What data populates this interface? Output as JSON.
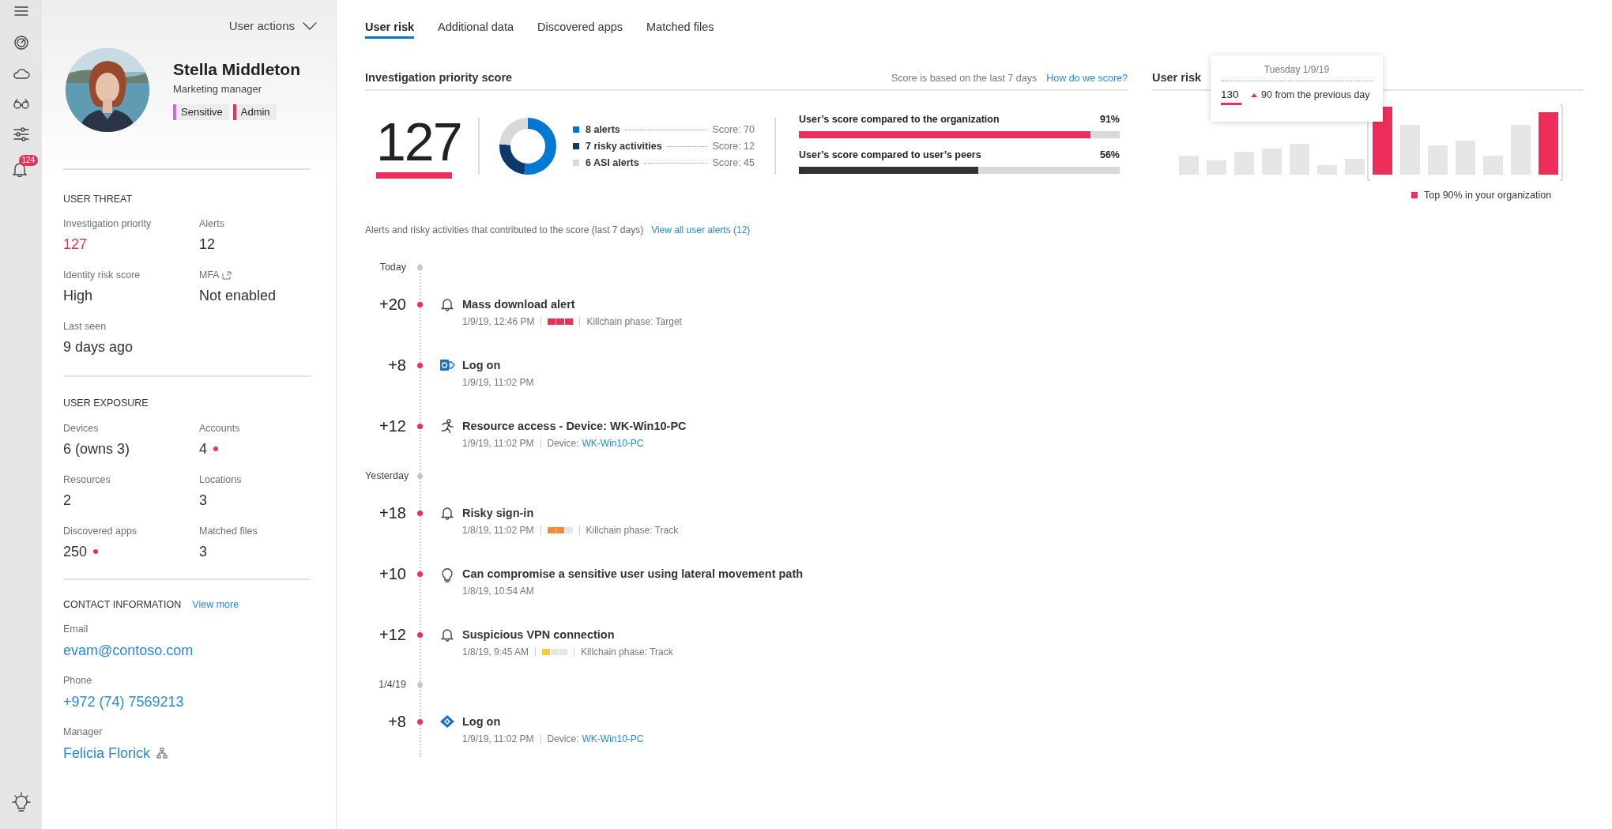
{
  "nav_rail": {
    "notification_badge": "124"
  },
  "profile": {
    "user_actions": "User actions",
    "name": "Stella Middleton",
    "job_title": "Marketing manager",
    "tags": [
      {
        "label": "Sensitive",
        "color": "#c86dd7"
      },
      {
        "label": "Admin",
        "color": "#e8325a"
      }
    ]
  },
  "user_threat": {
    "heading": "USER THREAT",
    "fields": [
      {
        "label": "Investigation priority",
        "value": "127",
        "kind": "score"
      },
      {
        "label": "Alerts",
        "value": "12",
        "kind": "plain"
      },
      {
        "label": "Identity risk score",
        "value": "High",
        "kind": "plain"
      },
      {
        "label": "MFA",
        "value": "Not enabled",
        "kind": "external"
      },
      {
        "label": "Last seen",
        "value": "9 days ago",
        "kind": "plain"
      }
    ]
  },
  "user_exposure": {
    "heading": "USER EXPOSURE",
    "fields": [
      {
        "label": "Devices",
        "value": "6 (owns 3)",
        "kind": "plain"
      },
      {
        "label": "Accounts",
        "value": "4",
        "kind": "flagged"
      },
      {
        "label": "Resources",
        "value": "2",
        "kind": "plain"
      },
      {
        "label": "Locations",
        "value": "3",
        "kind": "plain"
      },
      {
        "label": "Discovered apps",
        "value": "250",
        "kind": "flagged"
      },
      {
        "label": "Matched files",
        "value": "3",
        "kind": "plain"
      }
    ]
  },
  "contact_information": {
    "heading": "CONTACT INFORMATION",
    "view_more": "View more",
    "fields": [
      {
        "label": "Email",
        "value": "evam@contoso.com",
        "kind": "link"
      },
      {
        "label": "Phone",
        "value": "+972 (74) 7569213",
        "kind": "link"
      },
      {
        "label": "Manager",
        "value": "Felicia Florick",
        "kind": "org_link"
      }
    ]
  },
  "tabs": [
    {
      "label": "User risk",
      "selected": true
    },
    {
      "label": "Additional data",
      "selected": false
    },
    {
      "label": "Discovered apps",
      "selected": false
    },
    {
      "label": "Matched files",
      "selected": false
    }
  ],
  "priority_score": {
    "title": "Investigation priority score",
    "note": "Score is based on the last 7 days",
    "link": "How do we score?",
    "score": "127",
    "breakdown": [
      {
        "label": "8 alerts",
        "score": "Score: 70",
        "color": "#0078d4"
      },
      {
        "label": "7 risky activities",
        "score": "Score: 12",
        "color": "#0b3a6b"
      },
      {
        "label": "6 ASI alerts",
        "score": "Score: 45",
        "color": "#d9d9d9"
      }
    ],
    "comparisons": [
      {
        "label": "User’s score compared to the organization",
        "reading": "91%",
        "level": 0.91,
        "color": "#ee2d5a"
      },
      {
        "label": "User’s score compared to user’s peers",
        "reading": "56%",
        "level": 0.56,
        "color": "#333333"
      }
    ]
  },
  "contributing": {
    "text": "Alerts and risky activities that contributed to the score (last 7 days)",
    "link": "View all user alerts (12)"
  },
  "timeline": [
    {
      "kind": "date",
      "label": "Today"
    },
    {
      "kind": "alert",
      "points": "+20",
      "title": "Mass download alert",
      "time": "1/9/19, 12:46 PM",
      "severity": {
        "level": 1,
        "color": "#e8325a"
      },
      "killchain": "Killchain phase: Target"
    },
    {
      "kind": "sharepoint_logon",
      "points": "+8",
      "title": "Log on",
      "time": "1/9/19, 11:02 PM"
    },
    {
      "kind": "resource_access",
      "points": "+12",
      "title": "Resource access - Device: WK-Win10-PC",
      "time": "1/9/19, 11:02 PM",
      "device_label": "Device:",
      "device": "WK-Win10-PC"
    },
    {
      "kind": "date",
      "label": "Yesterday"
    },
    {
      "kind": "alert",
      "points": "+18",
      "title": "Risky sign-in",
      "time": "1/8/19, 11:02 PM",
      "severity": {
        "level": 0.67,
        "color": "#f7893b"
      },
      "killchain": "Killchain phase: Track"
    },
    {
      "kind": "lateral_movement",
      "points": "+10",
      "title": "Can compromise a sensitive user using lateral movement path",
      "time": "1/8/19, 10:54 AM"
    },
    {
      "kind": "alert",
      "points": "+12",
      "title": "Suspicious VPN connection",
      "time": "1/8/19, 9:45 AM",
      "severity": {
        "level": 0.33,
        "color": "#fccc33"
      },
      "killchain": "Killchain phase: Track"
    },
    {
      "kind": "date",
      "label": "1/4/19"
    },
    {
      "kind": "azure_logon",
      "points": "+8",
      "title": "Log on",
      "time": "1/9/19, 11:02 PM",
      "device_label": "Device:",
      "device": "WK-Win10-PC"
    }
  ],
  "user_risk_chart": {
    "title": "User risk",
    "legend": "Top 90% in your organization",
    "tooltip": {
      "date": "Tuesday 1/9/19",
      "value": "130",
      "change": "90 from the previous day"
    },
    "bars": [
      {
        "top": false
      },
      {
        "top": false
      },
      {
        "top": false
      },
      {
        "top": false
      },
      {
        "top": false
      },
      {
        "top": false
      },
      {
        "top": false
      },
      {
        "top": true
      },
      {
        "top": false
      },
      {
        "top": false
      },
      {
        "top": false
      },
      {
        "top": false
      },
      {
        "top": false
      },
      {
        "top": true
      }
    ]
  }
}
